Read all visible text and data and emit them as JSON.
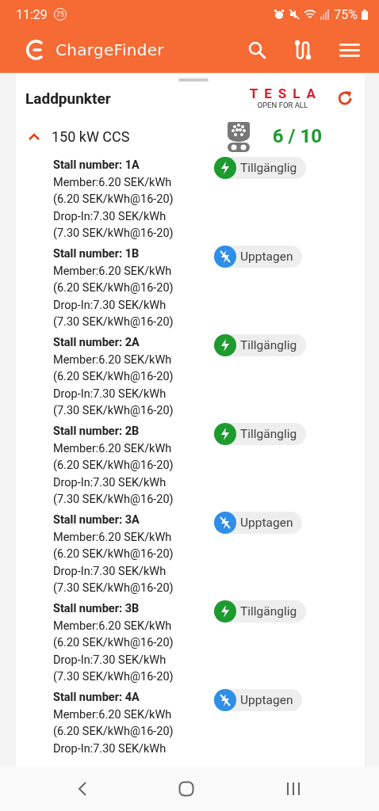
{
  "status_bar": {
    "time": "11:29",
    "notification_count": "75",
    "battery": "75%"
  },
  "app_bar": {
    "title": "ChargeFinder"
  },
  "panel": {
    "title": "Laddpunkter",
    "operator_logo": {
      "name": "TESLA",
      "tagline": "OPEN FOR ALL"
    }
  },
  "connector_group": {
    "expanded": true,
    "label": "150 kW CCS",
    "availability": "6 / 10",
    "stalls": [
      {
        "name": "Stall number: 1A",
        "lines": [
          "Member:6.20 SEK/kWh",
          "(6.20 SEK/kWh@16-20)",
          "Drop-In:7.30 SEK/kWh",
          "(7.30 SEK/kWh@16-20)"
        ],
        "status": {
          "kind": "available",
          "label": "Tillgänglig"
        }
      },
      {
        "name": "Stall number: 1B",
        "lines": [
          "Member:6.20 SEK/kWh",
          "(6.20 SEK/kWh@16-20)",
          "Drop-In:7.30 SEK/kWh",
          "(7.30 SEK/kWh@16-20)"
        ],
        "status": {
          "kind": "occupied",
          "label": "Upptagen"
        }
      },
      {
        "name": "Stall number: 2A",
        "lines": [
          "Member:6.20 SEK/kWh",
          "(6.20 SEK/kWh@16-20)",
          "Drop-In:7.30 SEK/kWh",
          "(7.30 SEK/kWh@16-20)"
        ],
        "status": {
          "kind": "available",
          "label": "Tillgänglig"
        }
      },
      {
        "name": "Stall number: 2B",
        "lines": [
          "Member:6.20 SEK/kWh",
          "(6.20 SEK/kWh@16-20)",
          "Drop-In:7.30 SEK/kWh",
          "(7.30 SEK/kWh@16-20)"
        ],
        "status": {
          "kind": "available",
          "label": "Tillgänglig"
        }
      },
      {
        "name": "Stall number: 3A",
        "lines": [
          "Member:6.20 SEK/kWh",
          "(6.20 SEK/kWh@16-20)",
          "Drop-In:7.30 SEK/kWh",
          "(7.30 SEK/kWh@16-20)"
        ],
        "status": {
          "kind": "occupied",
          "label": "Upptagen"
        }
      },
      {
        "name": "Stall number: 3B",
        "lines": [
          "Member:6.20 SEK/kWh",
          "(6.20 SEK/kWh@16-20)",
          "Drop-In:7.30 SEK/kWh",
          "(7.30 SEK/kWh@16-20)"
        ],
        "status": {
          "kind": "available",
          "label": "Tillgänglig"
        }
      },
      {
        "name": "Stall number: 4A",
        "lines": [
          "Member:6.20 SEK/kWh",
          "(6.20 SEK/kWh@16-20)",
          "Drop-In:7.30 SEK/kWh"
        ],
        "status": {
          "kind": "occupied",
          "label": "Upptagen"
        }
      }
    ]
  }
}
